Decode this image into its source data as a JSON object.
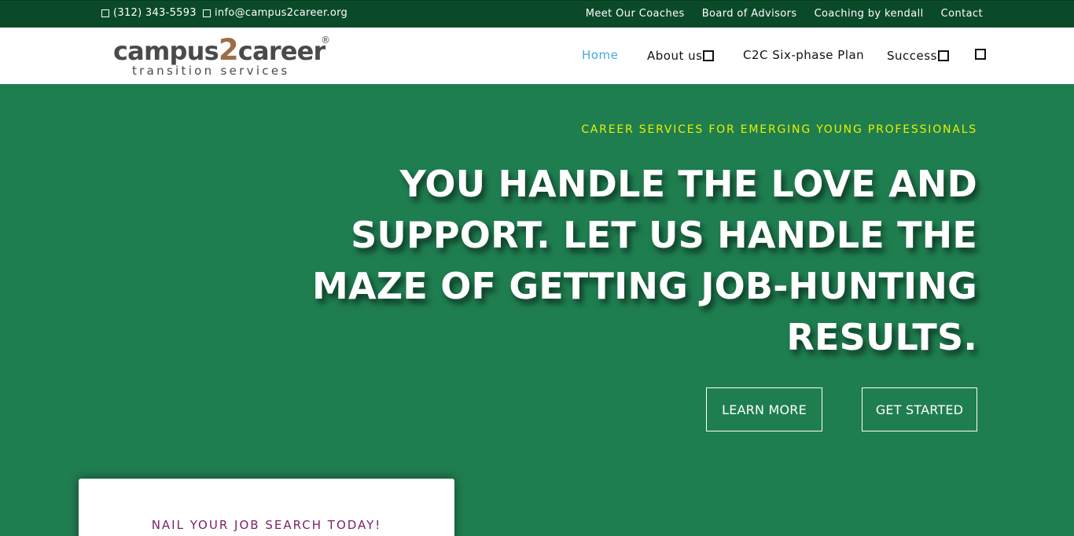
{
  "topbar": {
    "phone": "(312) 343-5593",
    "email": "info@campus2career.org",
    "links": [
      "Meet Our Coaches",
      "Board of Advisors",
      "Coaching by kendall",
      "Contact"
    ]
  },
  "logo": {
    "part1": "campus",
    "part2": "2",
    "part3": "career",
    "registered": "®",
    "tagline": "transition services"
  },
  "nav": {
    "home": "Home",
    "about": "About us",
    "plan": "C2C Six-phase Plan",
    "success": "Success"
  },
  "hero": {
    "subtitle": "CAREER SERVICES FOR EMERGING YOUNG PROFESSIONALS",
    "title": "YOU HANDLE THE LOVE AND SUPPORT. LET US HANDLE THE MAZE OF GETTING JOB-HUNTING RESULTS.",
    "learn_more": "LEARN MORE",
    "get_started": "GET STARTED"
  },
  "card": {
    "title": "NAIL YOUR JOB SEARCH TODAY!"
  },
  "colors": {
    "topbar_bg": "#0b4a28",
    "hero_bg": "#1f7e50",
    "accent_yellow": "#e8f000",
    "nav_active": "#4aa7df",
    "card_title": "#7a1f66",
    "logo_brown": "#9c6e46"
  }
}
